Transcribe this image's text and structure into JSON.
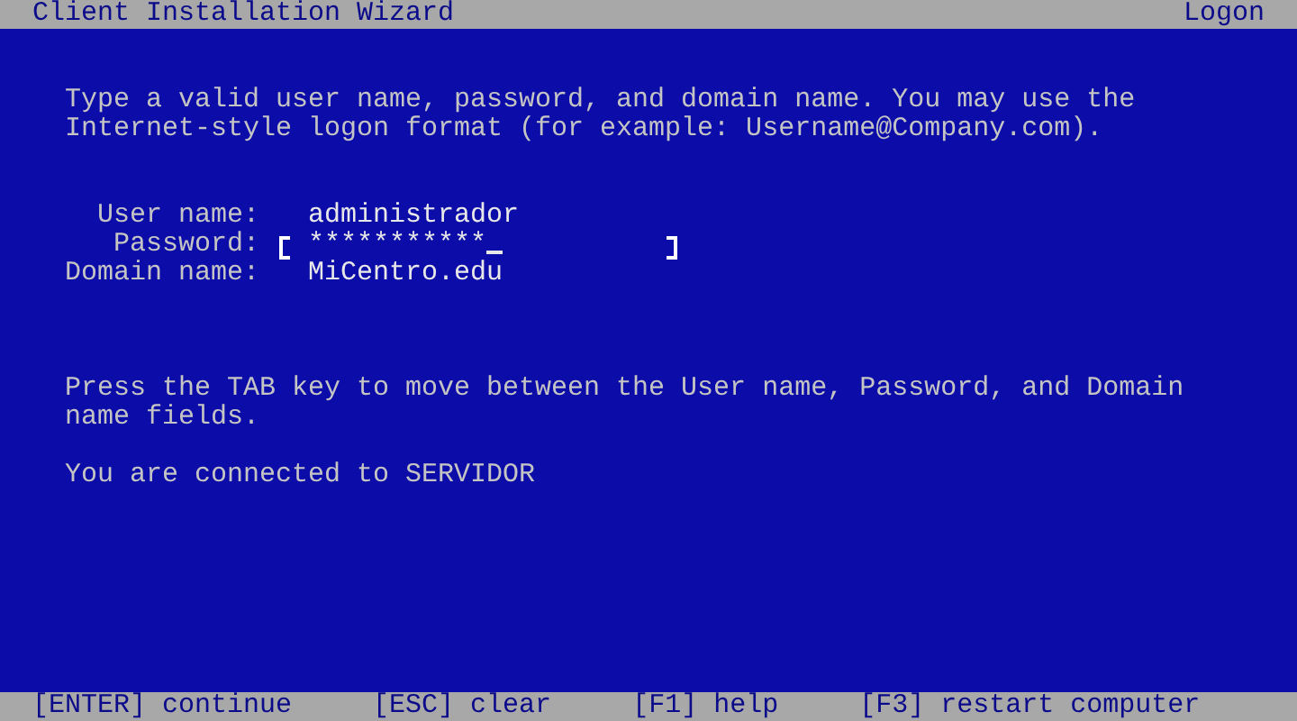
{
  "title_bar": {
    "title": "Client Installation Wizard",
    "section": "Logon"
  },
  "instructions": "Type a valid user name, password, and domain name. You may use the Internet-style logon format (for example: Username@Company.com).",
  "fields": [
    {
      "label": "User name:",
      "value": "administrador",
      "focused": false
    },
    {
      "label": "Password:",
      "value": "***********",
      "focused": true
    },
    {
      "label": "Domain name:",
      "value": "MiCentro.edu",
      "focused": false
    }
  ],
  "hint": "Press the TAB key to move between the User name, Password, and Domain name fields.",
  "connection": "You are connected to SERVIDOR",
  "status_bar": [
    "[ENTER] continue",
    "[ESC] clear",
    "[F1] help",
    "[F3] restart computer"
  ]
}
